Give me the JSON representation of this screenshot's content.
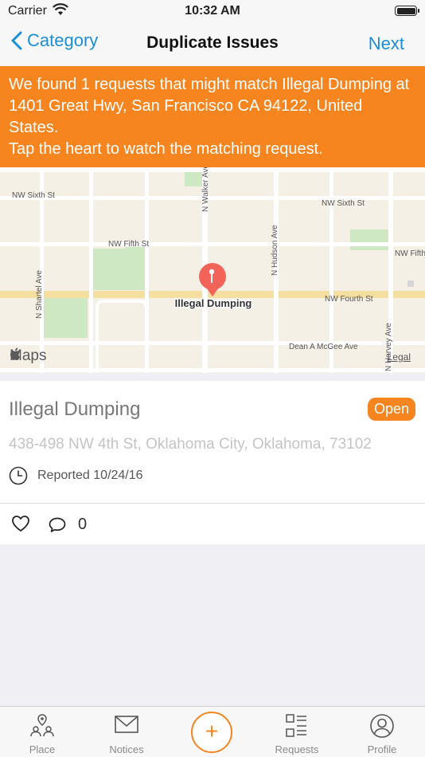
{
  "status_bar": {
    "carrier": "Carrier",
    "time": "10:32 AM"
  },
  "nav": {
    "back_label": "Category",
    "title": "Duplicate Issues",
    "next_label": "Next"
  },
  "banner": {
    "line1": "We found 1 requests that might match Illegal Dumping at 1401 Great Hwy, San Francisco CA 94122, United States.",
    "line2": "Tap the heart to watch the matching request."
  },
  "map": {
    "streets": {
      "nw_sixth_west": "NW Sixth St",
      "nw_sixth_east": "NW Sixth St",
      "nw_fifth_west": "NW Fifth St",
      "nw_fifth_east": "NW Fifth",
      "nw_fourth": "NW Fourth St",
      "dean_mcgee": "Dean A McGee Ave",
      "n_shartel": "N Shartel Ave",
      "n_walker": "N Walker Ave",
      "n_hudson": "N Hudson Ave",
      "n_harvey": "N Harvey Ave"
    },
    "pin_label": "Illegal Dumping",
    "logo_text": "Maps",
    "legal": "Legal",
    "colors": {
      "land": "#f5f0e6",
      "road": "#ffffff",
      "park": "#cfe8c4",
      "highway": "#f4dfa0",
      "pin": "#f2645a"
    }
  },
  "issue": {
    "title": "Illegal Dumping",
    "status": "Open",
    "address": "438-498 NW 4th St, Oklahoma City, Oklahoma, 73102",
    "reported": "Reported 10/24/16",
    "comment_count": "0"
  },
  "tabs": [
    {
      "label": "Place",
      "icon": "place-icon"
    },
    {
      "label": "Notices",
      "icon": "envelope-icon"
    },
    {
      "label": "+",
      "icon": "add-icon"
    },
    {
      "label": "Requests",
      "icon": "list-icon"
    },
    {
      "label": "Profile",
      "icon": "profile-icon"
    }
  ],
  "colors": {
    "accent": "#f6841f",
    "link": "#1a8fd8"
  }
}
